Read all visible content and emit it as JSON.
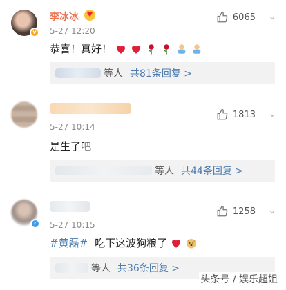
{
  "comments": [
    {
      "name": "李冰冰",
      "time": "5-27 12:20",
      "likes": "6065",
      "text": "恭喜！真好！",
      "text_emojis": [
        "heart-emoji",
        "heart-emoji",
        "rose-emoji",
        "rose-emoji",
        "baby-emoji",
        "baby-emoji"
      ],
      "reply_suffix": "等人",
      "reply_link": "共81条回复 >",
      "verified_badge_color": "#f5a623"
    },
    {
      "time": "5-27 10:14",
      "likes": "1813",
      "text": "是生了吧",
      "reply_suffix": "等人",
      "reply_link": "共44条回复 >"
    },
    {
      "time": "5-27 10:15",
      "likes": "1258",
      "topic": "#黄磊#",
      "text": "吃下这波狗粮了",
      "text_emojis": [
        "heart-emoji",
        "doge-emoji"
      ],
      "reply_suffix": "等人",
      "reply_link": "共36条回复 >",
      "verified_badge_color": "#3d9be9"
    }
  ],
  "watermark": "头条号 / 娱乐超姐",
  "colors": {
    "name": "#eb7350",
    "link": "#507daf",
    "reply_bg": "#f2f2f2"
  }
}
